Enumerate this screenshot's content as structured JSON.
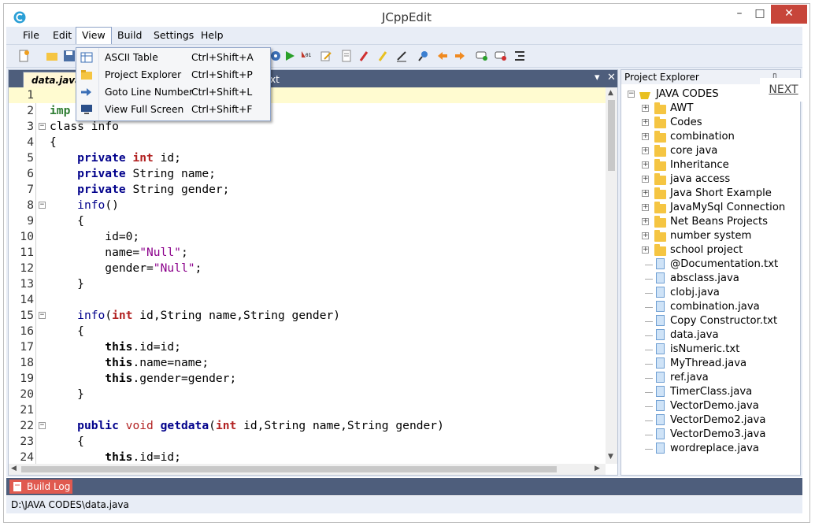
{
  "window": {
    "title": "JCppEdit",
    "minimize": "–",
    "maximize": "□",
    "close": "✕"
  },
  "menubar": [
    "File",
    "Edit",
    "View",
    "Build",
    "Settings",
    "Help"
  ],
  "view_menu": [
    {
      "label": "ASCII Table",
      "shortcut": "Ctrl+Shift+A"
    },
    {
      "label": "Project Explorer",
      "shortcut": "Ctrl+Shift+P"
    },
    {
      "label": "Goto Line Number",
      "shortcut": "Ctrl+Shift+L"
    },
    {
      "label": "View Full Screen",
      "shortcut": "Ctrl+Shift+F"
    }
  ],
  "editor": {
    "tabs": [
      "data.java",
      "xt"
    ],
    "tab_controls": {
      "dropdown": "▾",
      "close": "✕"
    },
    "lines": [
      {
        "n": "1",
        "fold": "",
        "code": ""
      },
      {
        "n": "2",
        "fold": "",
        "code": "imp"
      },
      {
        "n": "3",
        "fold": "−",
        "code": "class info"
      },
      {
        "n": "4",
        "fold": "",
        "code": "{"
      },
      {
        "n": "5",
        "fold": "",
        "code": "    private int id;"
      },
      {
        "n": "6",
        "fold": "",
        "code": "    private String name;"
      },
      {
        "n": "7",
        "fold": "",
        "code": "    private String gender;"
      },
      {
        "n": "8",
        "fold": "−",
        "code": "    info()"
      },
      {
        "n": "9",
        "fold": "",
        "code": "    {"
      },
      {
        "n": "10",
        "fold": "",
        "code": "        id=0;"
      },
      {
        "n": "11",
        "fold": "",
        "code": "        name=\"Null\";"
      },
      {
        "n": "12",
        "fold": "",
        "code": "        gender=\"Null\";"
      },
      {
        "n": "13",
        "fold": "",
        "code": "    }"
      },
      {
        "n": "14",
        "fold": "",
        "code": ""
      },
      {
        "n": "15",
        "fold": "−",
        "code": "    info(int id,String name,String gender)"
      },
      {
        "n": "16",
        "fold": "",
        "code": "    {"
      },
      {
        "n": "17",
        "fold": "",
        "code": "        this.id=id;"
      },
      {
        "n": "18",
        "fold": "",
        "code": "        this.name=name;"
      },
      {
        "n": "19",
        "fold": "",
        "code": "        this.gender=gender;"
      },
      {
        "n": "20",
        "fold": "",
        "code": "    }"
      },
      {
        "n": "21",
        "fold": "",
        "code": ""
      },
      {
        "n": "22",
        "fold": "−",
        "code": "    public void getdata(int id,String name,String gender)"
      },
      {
        "n": "23",
        "fold": "",
        "code": "    {"
      },
      {
        "n": "24",
        "fold": "",
        "code": "        this.id=id;"
      }
    ]
  },
  "explorer": {
    "title": "Project Explorer",
    "pin": "📌",
    "next_label": "NEXT",
    "root": "JAVA CODES",
    "folders": [
      "AWT",
      "Codes",
      "combination",
      "core java",
      "Inheritance",
      "java access",
      "Java Short Example",
      "JavaMySql Connection",
      "Net Beans Projects",
      "number system",
      "school project"
    ],
    "files": [
      "@Documentation.txt",
      "absclass.java",
      "clobj.java",
      "combination.java",
      "Copy Constructor.txt",
      "data.java",
      "isNumeric.txt",
      "MyThread.java",
      "ref.java",
      "TimerClass.java",
      "VectorDemo.java",
      "VectorDemo2.java",
      "VectorDemo3.java",
      "wordreplace.java"
    ]
  },
  "build_log": "Build Log",
  "status": "D:\\JAVA CODES\\data.java",
  "colors": {
    "accent": "#4e5e7c",
    "close": "#c7453a",
    "keyword": "#00008b",
    "type": "#b22222",
    "string": "#8b008b"
  }
}
